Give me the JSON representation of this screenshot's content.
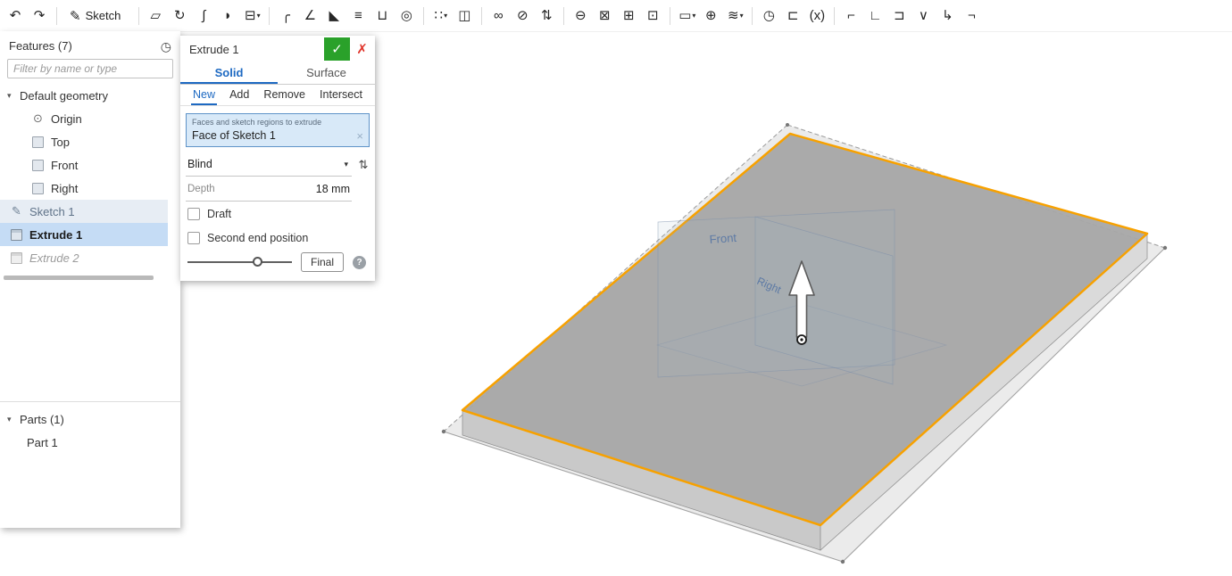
{
  "toolbar": {
    "items": [
      {
        "type": "icon",
        "name": "undo-button",
        "icon_name": "undo-icon",
        "glyph": "↶"
      },
      {
        "type": "icon",
        "name": "redo-button",
        "icon_name": "redo-icon",
        "glyph": "↷"
      },
      {
        "type": "sep",
        "name": "separator",
        "interactable": false
      },
      {
        "type": "button",
        "name": "sketch-button",
        "icon_name": "pencil-icon",
        "glyph": "✎",
        "label": "Sketch"
      },
      {
        "type": "sep",
        "name": "separator",
        "interactable": false
      },
      {
        "type": "icon",
        "name": "extrude-tool",
        "icon_name": "extrude-icon",
        "glyph": "▱"
      },
      {
        "type": "icon",
        "name": "revolve-tool",
        "icon_name": "revolve-icon",
        "glyph": "↻"
      },
      {
        "type": "icon",
        "name": "sweep-tool",
        "icon_name": "sweep-icon",
        "glyph": "∫"
      },
      {
        "type": "icon",
        "name": "loft-tool",
        "icon_name": "loft-icon",
        "glyph": "◗"
      },
      {
        "type": "icon",
        "name": "thicken-tool",
        "icon_name": "thicken-icon",
        "glyph": "⊟",
        "caret_glyph": "▾"
      },
      {
        "type": "sep",
        "name": "separator",
        "interactable": false
      },
      {
        "type": "icon",
        "name": "fillet-tool",
        "icon_name": "fillet-icon",
        "glyph": "╭"
      },
      {
        "type": "icon",
        "name": "chamfer-tool",
        "icon_name": "chamfer-icon",
        "glyph": "∠"
      },
      {
        "type": "icon",
        "name": "draft-tool",
        "icon_name": "draft-icon",
        "glyph": "◣"
      },
      {
        "type": "icon",
        "name": "rib-tool",
        "icon_name": "rib-icon",
        "glyph": "≡"
      },
      {
        "type": "icon",
        "name": "shell-tool",
        "icon_name": "shell-icon",
        "glyph": "⊔"
      },
      {
        "type": "icon",
        "name": "hole-tool",
        "icon_name": "hole-icon",
        "glyph": "◎"
      },
      {
        "type": "sep",
        "name": "separator",
        "interactable": false
      },
      {
        "type": "icon",
        "name": "linear-pattern-tool",
        "icon_name": "pattern-icon",
        "glyph": "∷",
        "caret_glyph": "▾"
      },
      {
        "type": "icon",
        "name": "mirror-tool",
        "icon_name": "mirror-icon",
        "glyph": "◫"
      },
      {
        "type": "sep",
        "name": "separator",
        "interactable": false
      },
      {
        "type": "icon",
        "name": "boolean-tool",
        "icon_name": "boolean-icon",
        "glyph": "∞"
      },
      {
        "type": "icon",
        "name": "split-tool",
        "icon_name": "split-icon",
        "glyph": "⊘"
      },
      {
        "type": "icon",
        "name": "transform-tool",
        "icon_name": "transform-icon",
        "glyph": "⇅"
      },
      {
        "type": "sep",
        "name": "separator",
        "interactable": false
      },
      {
        "type": "icon",
        "name": "offset-surface-tool",
        "icon_name": "offset-surface-icon",
        "glyph": "⊖"
      },
      {
        "type": "icon",
        "name": "delete-face-tool",
        "icon_name": "delete-face-icon",
        "glyph": "⊠"
      },
      {
        "type": "icon",
        "name": "move-face-tool",
        "icon_name": "move-face-icon",
        "glyph": "⊞"
      },
      {
        "type": "icon",
        "name": "replace-face-tool",
        "icon_name": "replace-face-icon",
        "glyph": "⊡"
      },
      {
        "type": "sep",
        "name": "separator",
        "interactable": false
      },
      {
        "type": "icon",
        "name": "plane-tool",
        "icon_name": "plane-icon",
        "glyph": "▭",
        "caret_glyph": "▾"
      },
      {
        "type": "icon",
        "name": "mate-connector-tool",
        "icon_name": "mate-connector-icon",
        "glyph": "⊕"
      },
      {
        "type": "icon",
        "name": "helix-tool",
        "icon_name": "helix-icon",
        "glyph": "≋",
        "caret_glyph": "▾"
      },
      {
        "type": "sep",
        "name": "separator",
        "interactable": false
      },
      {
        "type": "icon",
        "name": "measure-tool",
        "icon_name": "measure-icon",
        "glyph": "◷"
      },
      {
        "type": "icon",
        "name": "sheet-metal-tool",
        "icon_name": "sheet-metal-icon",
        "glyph": "⊏"
      },
      {
        "type": "icon",
        "name": "variable-tool",
        "icon_name": "variable-icon",
        "glyph": "(x)"
      },
      {
        "type": "sep",
        "name": "separator",
        "interactable": false
      },
      {
        "type": "icon",
        "name": "frame-tool",
        "icon_name": "frame-icon",
        "glyph": "⌐"
      },
      {
        "type": "icon",
        "name": "flange-tool",
        "icon_name": "flange-icon",
        "glyph": "∟"
      },
      {
        "type": "icon",
        "name": "tab-tool",
        "icon_name": "tab-icon",
        "glyph": "⊐"
      },
      {
        "type": "icon",
        "name": "convert-tool",
        "icon_name": "convert-icon",
        "glyph": "∨"
      },
      {
        "type": "icon",
        "name": "export-tool",
        "icon_name": "export-icon",
        "glyph": "↳"
      },
      {
        "type": "icon",
        "name": "corner-tool",
        "icon_name": "corner-icon",
        "glyph": "¬"
      }
    ]
  },
  "features_panel": {
    "title": "Features (7)",
    "filter_placeholder": "Filter by name or type",
    "default_geometry_label": "Default geometry",
    "geometry_items": [
      {
        "name": "feature-origin",
        "label": "Origin",
        "icon": "origin",
        "icon_name": "origin-icon"
      },
      {
        "name": "feature-plane-top",
        "label": "Top",
        "icon": "plane",
        "icon_name": "plane-icon"
      },
      {
        "name": "feature-plane-front",
        "label": "Front",
        "icon": "plane",
        "icon_name": "plane-icon"
      },
      {
        "name": "feature-plane-right",
        "label": "Right",
        "icon": "plane",
        "icon_name": "plane-icon"
      }
    ],
    "feature_items": [
      {
        "name": "feature-sketch-1",
        "label": "Sketch 1",
        "icon": "sketch",
        "icon_name": "sketch-icon",
        "state": "highlighted"
      },
      {
        "name": "feature-extrude-1",
        "label": "Extrude 1",
        "icon": "extrude",
        "icon_name": "extrude-icon",
        "state": "selected"
      },
      {
        "name": "feature-extrude-2",
        "label": "Extrude 2",
        "icon": "extrude",
        "icon_name": "extrude-icon",
        "state": "rolled-back"
      }
    ],
    "parts_label": "Parts (1)",
    "part_items": [
      {
        "name": "part-1",
        "label": "Part 1"
      }
    ]
  },
  "dialog": {
    "title": "Extrude 1",
    "tabs": [
      {
        "name": "tab-solid",
        "label": "Solid",
        "state": "active"
      },
      {
        "name": "tab-surface",
        "label": "Surface",
        "state": ""
      }
    ],
    "op_tabs": [
      {
        "name": "op-tab-new",
        "label": "New",
        "state": "active"
      },
      {
        "name": "op-tab-add",
        "label": "Add",
        "state": ""
      },
      {
        "name": "op-tab-remove",
        "label": "Remove",
        "state": ""
      },
      {
        "name": "op-tab-intersect",
        "label": "Intersect",
        "state": ""
      }
    ],
    "selection_caption": "Faces and sketch regions to extrude",
    "selection_value": "Face of Sketch 1",
    "end_condition": "Blind",
    "depth_label": "Depth",
    "depth_value": "18 mm",
    "draft_label": "Draft",
    "second_end_label": "Second end position",
    "final_label": "Final"
  },
  "icons": {
    "history": "◷",
    "chevron_down": "▾",
    "dropdown_caret": "▾",
    "check": "✓",
    "close": "✗",
    "clear": "×",
    "opposite_direction": "⇅",
    "help": "?"
  },
  "viewport": {
    "front_label": "Front",
    "right_label": "Right"
  },
  "colors": {
    "accent_blue": "#1d69c2",
    "highlight_orange": "#f7a100",
    "commit_green": "#2aa12a",
    "cancel_red": "#e0352b",
    "selected_row_blue": "#c5dcf5"
  }
}
